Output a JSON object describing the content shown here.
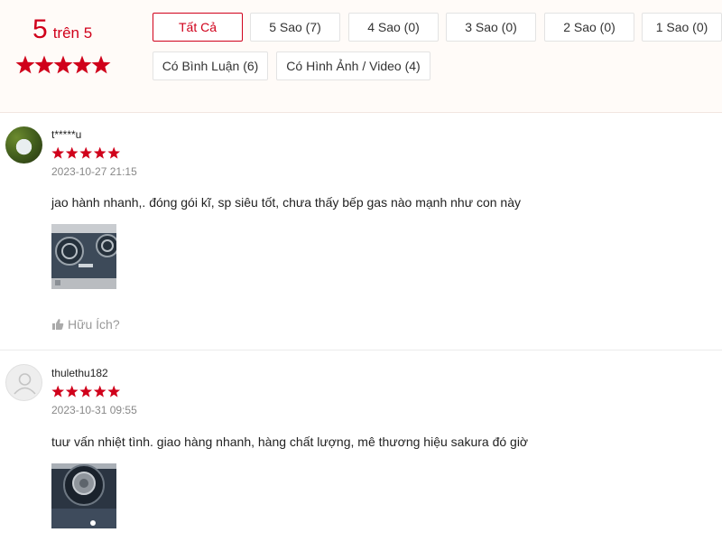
{
  "rating_summary": {
    "score": "5",
    "out_of": "trên 5",
    "stars": 5
  },
  "filters": [
    "Tất Cả",
    "5 Sao (7)",
    "4 Sao (0)",
    "3 Sao (0)",
    "2 Sao (0)",
    "1 Sao (0)",
    "Có Bình Luận (6)",
    "Có Hình Ảnh / Video (4)"
  ],
  "active_filter": "Tất Cả",
  "colors": {
    "accent": "#d0011b",
    "summary_background": "#fffbf8"
  },
  "reviews": [
    {
      "username": "t*****u",
      "stars": 5,
      "date": "2023-10-27 21:15",
      "text": "jao hành nhanh,. đóng gói kĩ, sp siêu tốt, chưa thấy bếp gas nào mạnh như con này",
      "helpful_label": "Hữu Ích?",
      "avatar_icon": "user-photo-avatar",
      "image_icon": "gas-stove-photo"
    },
    {
      "username": "thulethu182",
      "stars": 5,
      "date": "2023-10-31 09:55",
      "text": "tuư vấn nhiệt tình. giao hàng nhanh, hàng chất lượng, mê thương hiệu sakura đó giờ",
      "avatar_icon": "default-user-avatar",
      "image_icon": "gas-stove-burner-photo"
    }
  ]
}
